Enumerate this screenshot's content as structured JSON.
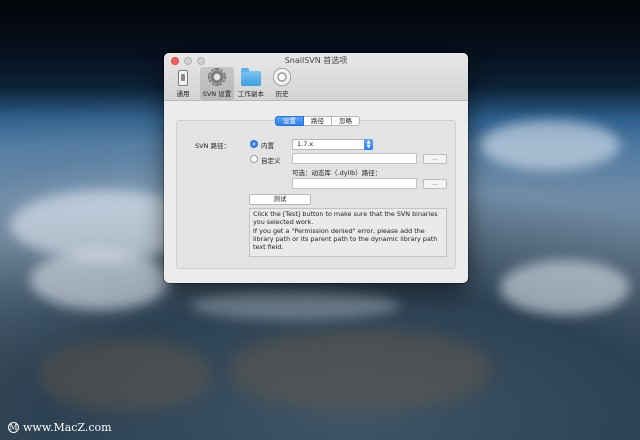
{
  "window": {
    "title": "SnailSVN 首选项"
  },
  "toolbar": {
    "items": [
      {
        "label": "通用",
        "icon": "phone-icon"
      },
      {
        "label": "SVN 设置",
        "icon": "gear-icon",
        "selected": true
      },
      {
        "label": "工作副本",
        "icon": "folder-icon"
      },
      {
        "label": "历史",
        "icon": "history-icon"
      }
    ]
  },
  "tabs": [
    {
      "label": "设置",
      "active": true
    },
    {
      "label": "路径",
      "active": false
    },
    {
      "label": "忽略",
      "active": false
    }
  ],
  "settings": {
    "svn_path_label": "SVN 路径：",
    "builtin_label": "内置",
    "builtin_selected": true,
    "version_value": "1.7.x",
    "custom_label": "自定义",
    "custom_path_value": "",
    "browse_label": "...",
    "optional_label": "可选：动态库（.dylib）路径：",
    "dylib_path_value": "",
    "test_button": "测试",
    "help_lines": [
      "Click the [Test] button to make sure that the SVN binaries",
      "you selected work.",
      "If you get a \"Permission denied\" error, please add the",
      "library path or its parent path to the dynamic library path",
      "text field."
    ]
  },
  "watermark": "www.MacZ.com",
  "colors": {
    "accent": "#2c7ff2",
    "close": "#fc605c"
  }
}
